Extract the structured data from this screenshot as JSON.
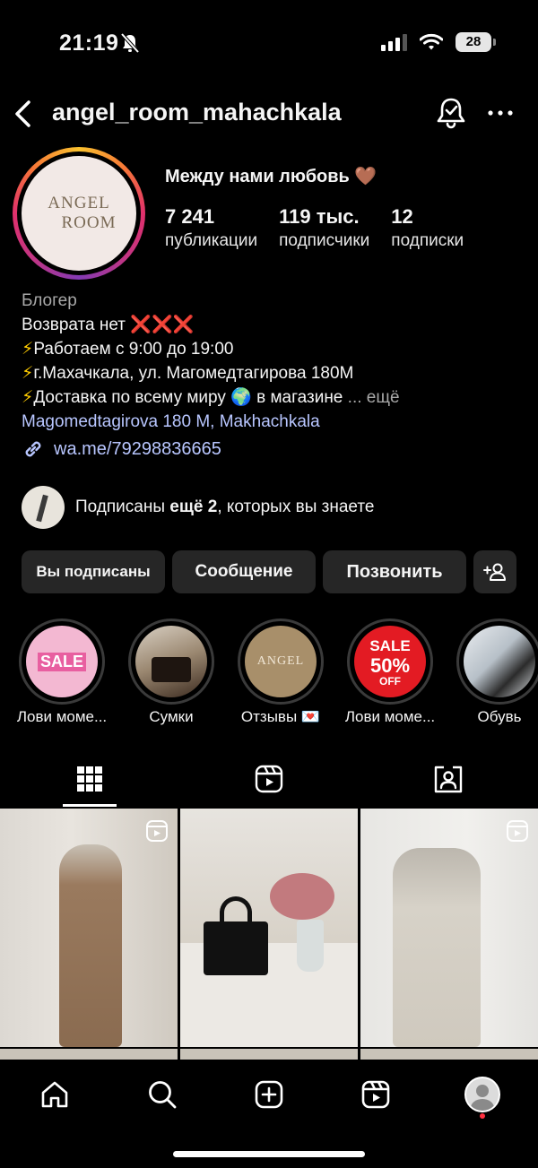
{
  "status_bar": {
    "time": "21:19",
    "battery": "28"
  },
  "header": {
    "username": "angel_room_mahachkala"
  },
  "profile": {
    "avatar_line1": "ANGEL",
    "avatar_line2": "ROOM",
    "name": "Между нами любовь",
    "name_emoji": "🤎",
    "stats": [
      {
        "value": "7 241",
        "label": "публикации"
      },
      {
        "value": "119 тыс.",
        "label": "подписчики"
      },
      {
        "value": "12",
        "label": "подписки"
      }
    ],
    "category": "Блогер",
    "bio_line1": "Возврата нет",
    "bio_line1_emoji": "❌❌❌",
    "bio_line2": "Работаем с 9:00 до 19:00",
    "bio_line3": "г.Махачкала, ул. Магомедтагирова 180М",
    "bio_line4": "Доставка по всему миру",
    "bio_line4_globe": "🌍",
    "bio_line4_tail": "в магазине",
    "bio_more": "... ещё",
    "bolt": "⚡",
    "location": "Magomedtagirova 180  M, Makhachkala",
    "link": "wa.me/79298836665",
    "followed_by_prefix": "Подписаны ",
    "followed_by_bold": "ещё 2",
    "followed_by_suffix": ", которых вы знаете"
  },
  "actions": {
    "following": "Вы подписаны",
    "message": "Сообщение",
    "call": "Позвонить"
  },
  "highlights": [
    {
      "label": "Лови моме...",
      "img_text": "SALE"
    },
    {
      "label": "Сумки"
    },
    {
      "label": "Отзывы 💌",
      "img_text": "ANGEL"
    },
    {
      "label": "Лови моме...",
      "img_text1": "SALE",
      "img_text2": "50%",
      "img_text3": "OFF"
    },
    {
      "label": "Обувь"
    }
  ],
  "colors": {
    "background": "#000000",
    "button": "#262626",
    "link": "#b8c6ff",
    "muted": "#a8a8a8",
    "notification_dot": "#ff3040"
  },
  "icons": [
    "bell-slash-icon",
    "chevron-left-icon",
    "bell-check-icon",
    "more-icon",
    "link-icon",
    "add-person-icon",
    "grid-icon",
    "reels-icon",
    "tagged-icon",
    "home-icon",
    "search-icon",
    "create-icon",
    "reels-nav-icon"
  ]
}
